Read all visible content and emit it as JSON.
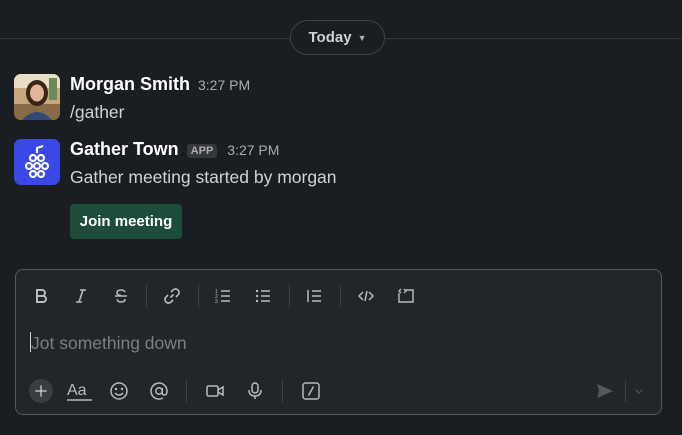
{
  "date_divider": {
    "label": "Today"
  },
  "messages": [
    {
      "author": "Morgan Smith",
      "time": "3:27 PM",
      "text": "/gather"
    },
    {
      "author": "Gather Town",
      "badge": "APP",
      "time": "3:27 PM",
      "text": "Gather meeting started by morgan",
      "button_label": "Join meeting"
    }
  ],
  "composer": {
    "placeholder": "Jot something down",
    "format_tools": [
      "bold-icon",
      "italic-icon",
      "strikethrough-icon",
      "link-icon",
      "ordered-list-icon",
      "bulleted-list-icon",
      "blockquote-icon",
      "code-icon",
      "code-block-icon"
    ],
    "action_tools": [
      "plus-icon",
      "formatting-icon",
      "emoji-icon",
      "mention-icon",
      "video-icon",
      "microphone-icon",
      "slash-command-icon",
      "send-icon",
      "chevron-down-icon"
    ]
  },
  "colors": {
    "background": "#1a1d21",
    "join_button": "#1d4d3a",
    "gather_logo": "#3a49e5"
  }
}
